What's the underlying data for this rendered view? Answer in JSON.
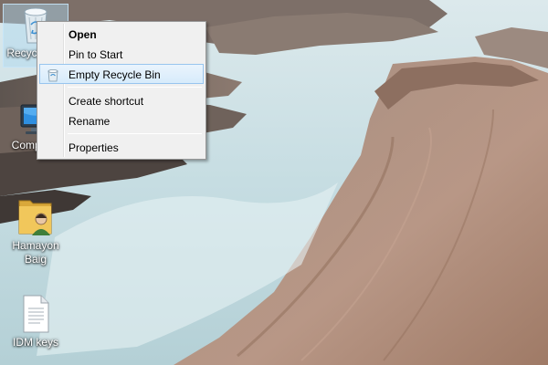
{
  "desktop": {
    "icons": [
      {
        "label": "Recycle Bin",
        "icon": "recycle-bin-icon",
        "selected": true
      },
      {
        "label": "Computer",
        "icon": "computer-icon"
      },
      {
        "label": "Hamayon Baig",
        "icon": "user-folder-icon"
      },
      {
        "label": "IDM keys",
        "icon": "text-document-icon"
      }
    ]
  },
  "context_menu": {
    "items": [
      {
        "label": "Open",
        "bold": true
      },
      {
        "label": "Pin to Start"
      },
      {
        "label": "Empty Recycle Bin",
        "icon": "recycle-bin-icon",
        "hovered": true
      },
      {
        "label": "Create shortcut"
      },
      {
        "label": "Rename"
      },
      {
        "label": "Properties"
      }
    ]
  },
  "colors": {
    "menu_background": "#f0f0f0",
    "menu_hover": "#d7ebfb",
    "menu_hover_border": "#98c5ee"
  }
}
